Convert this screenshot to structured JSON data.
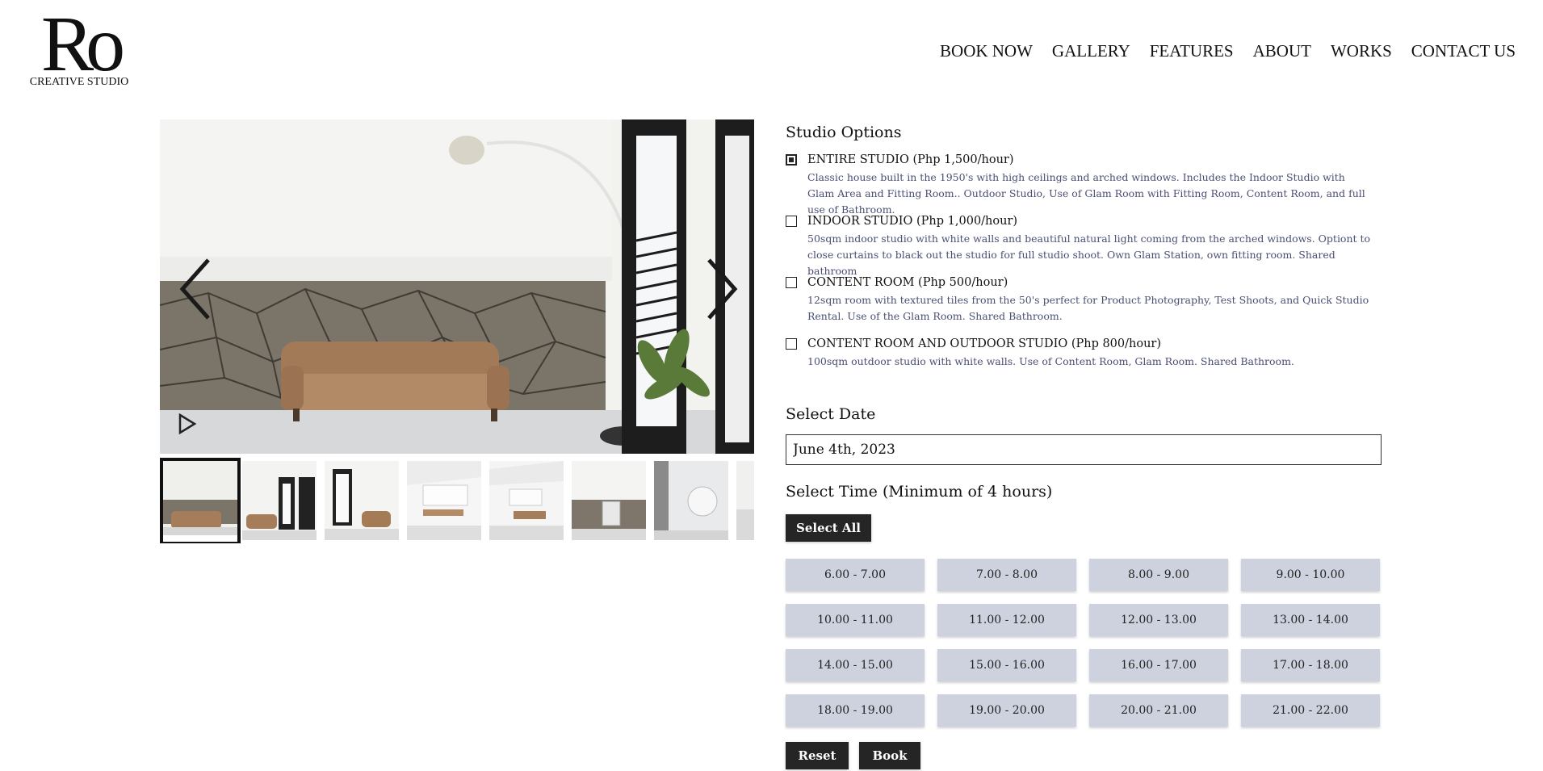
{
  "brand": {
    "logo_mark": "Ro",
    "logo_sub": "CREATIVE STUDIO"
  },
  "nav": {
    "items": [
      "BOOK NOW",
      "GALLERY",
      "FEATURES",
      "ABOUT",
      "WORKS",
      "CONTACT US"
    ]
  },
  "gallery": {
    "prev_icon": "chevron-left-icon",
    "next_icon": "chevron-right-icon",
    "play_icon": "play-icon",
    "thumbnail_count": 8,
    "active_thumbnail": 1
  },
  "studio_options": {
    "heading": "Studio Options",
    "options": [
      {
        "title": "ENTIRE STUDIO (Php 1,500/hour)",
        "description": "Classic house built in the 1950's with high ceilings and arched windows. Includes the Indoor Studio with Glam Area and Fitting Room.. Outdoor Studio, Use of Glam Room with Fitting Room, Content Room, and full use of Bathroom.",
        "checked": true
      },
      {
        "title": "INDOOR STUDIO (Php 1,000/hour)",
        "description": "50sqm indoor studio with white walls and beautiful natural light coming from the arched windows. Optiont to close curtains to black out the studio for full studio shoot. Own Glam Station, own fitting room. Shared bathroom",
        "checked": false
      },
      {
        "title": "CONTENT ROOM (Php 500/hour)",
        "description": "12sqm room with textured tiles from the 50's perfect for Product Photography, Test Shoots, and Quick Studio Rental. Use of the Glam Room. Shared Bathroom.",
        "checked": false
      },
      {
        "title": "CONTENT ROOM AND OUTDOOR STUDIO (Php 800/hour)",
        "description": "100sqm outdoor studio with white walls. Use of Content Room, Glam Room. Shared Bathroom.",
        "checked": false
      }
    ]
  },
  "date": {
    "heading": "Select Date",
    "value": "June 4th, 2023"
  },
  "time": {
    "heading": "Select Time (Minimum of 4 hours)",
    "select_all_label": "Select All",
    "slots": [
      "6.00 - 7.00",
      "7.00 - 8.00",
      "8.00 - 9.00",
      "9.00 - 10.00",
      "10.00 - 11.00",
      "11.00 - 12.00",
      "12.00 - 13.00",
      "13.00 - 14.00",
      "14.00 - 15.00",
      "15.00 - 16.00",
      "16.00 - 17.00",
      "17.00 - 18.00",
      "18.00 - 19.00",
      "19.00 - 20.00",
      "20.00 - 21.00",
      "21.00 - 22.00"
    ]
  },
  "actions": {
    "reset_label": "Reset",
    "book_label": "Book"
  },
  "colors": {
    "slot_bg": "#ced2de",
    "dark_button": "#252525",
    "description_text": "#4a4f72"
  }
}
